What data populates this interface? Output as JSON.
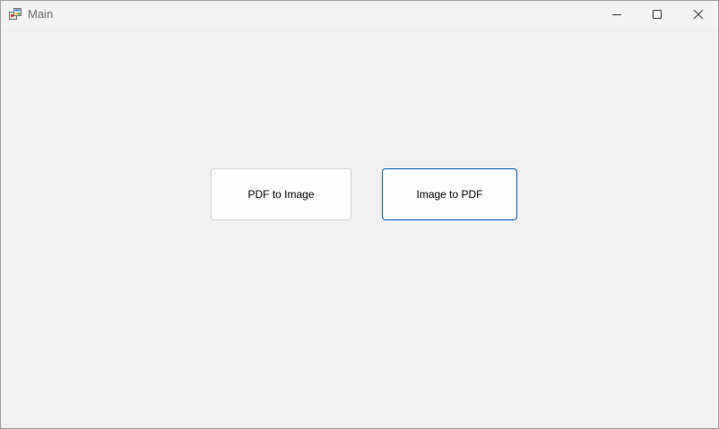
{
  "window": {
    "title": "Main",
    "app_icon": "winforms-app-icon",
    "controls": {
      "minimize_icon": "minimize-icon",
      "maximize_icon": "maximize-icon",
      "close_icon": "close-icon"
    }
  },
  "main": {
    "buttons": {
      "pdf_to_image": "PDF to Image",
      "image_to_pdf": "Image to PDF"
    }
  },
  "colors": {
    "background": "#f0f0f0",
    "focus_border": "#005fb8"
  }
}
